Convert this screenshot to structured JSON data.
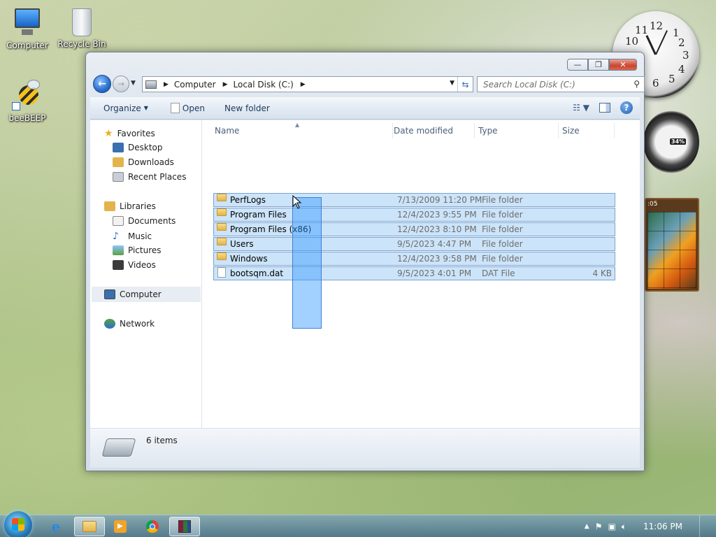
{
  "desktop": {
    "icons": [
      {
        "label": "Computer"
      },
      {
        "label": "Recycle Bin"
      },
      {
        "label": "beeBEEP"
      }
    ]
  },
  "gadgets": {
    "clock_numbers": [
      "12",
      "1",
      "2",
      "3",
      "4",
      "5",
      "6",
      "10",
      "11"
    ],
    "meter_percent": "34%",
    "puzzle_time": ":05"
  },
  "window": {
    "address": {
      "crumbs": [
        "Computer",
        "Local Disk (C:)"
      ]
    },
    "search": {
      "placeholder": "Search Local Disk (C:)"
    },
    "commands": {
      "organize": "Organize",
      "open": "Open",
      "new_folder": "New folder"
    },
    "nav_pane": {
      "favorites": "Favorites",
      "favorites_items": [
        "Desktop",
        "Downloads",
        "Recent Places"
      ],
      "libraries": "Libraries",
      "libraries_items": [
        "Documents",
        "Music",
        "Pictures",
        "Videos"
      ],
      "computer": "Computer",
      "network": "Network"
    },
    "columns": [
      "Name",
      "Date modified",
      "Type",
      "Size"
    ],
    "files": [
      {
        "name": "PerfLogs",
        "date": "7/13/2009 11:20 PM",
        "type": "File folder",
        "size": "",
        "kind": "folder"
      },
      {
        "name": "Program Files",
        "date": "12/4/2023 9:55 PM",
        "type": "File folder",
        "size": "",
        "kind": "folder"
      },
      {
        "name": "Program Files (x86)",
        "date": "12/4/2023 8:10 PM",
        "type": "File folder",
        "size": "",
        "kind": "folder"
      },
      {
        "name": "Users",
        "date": "9/5/2023 4:47 PM",
        "type": "File folder",
        "size": "",
        "kind": "folder"
      },
      {
        "name": "Windows",
        "date": "12/4/2023 9:58 PM",
        "type": "File folder",
        "size": "",
        "kind": "folder"
      },
      {
        "name": "bootsqm.dat",
        "date": "9/5/2023 4:01 PM",
        "type": "DAT File",
        "size": "4 KB",
        "kind": "file"
      }
    ],
    "status": "6 items"
  },
  "taskbar": {
    "time": "11:06 PM"
  },
  "colors": {
    "selection": "#cce4f9",
    "selection_border": "#7da2ce",
    "lasso": "#3399ff"
  }
}
